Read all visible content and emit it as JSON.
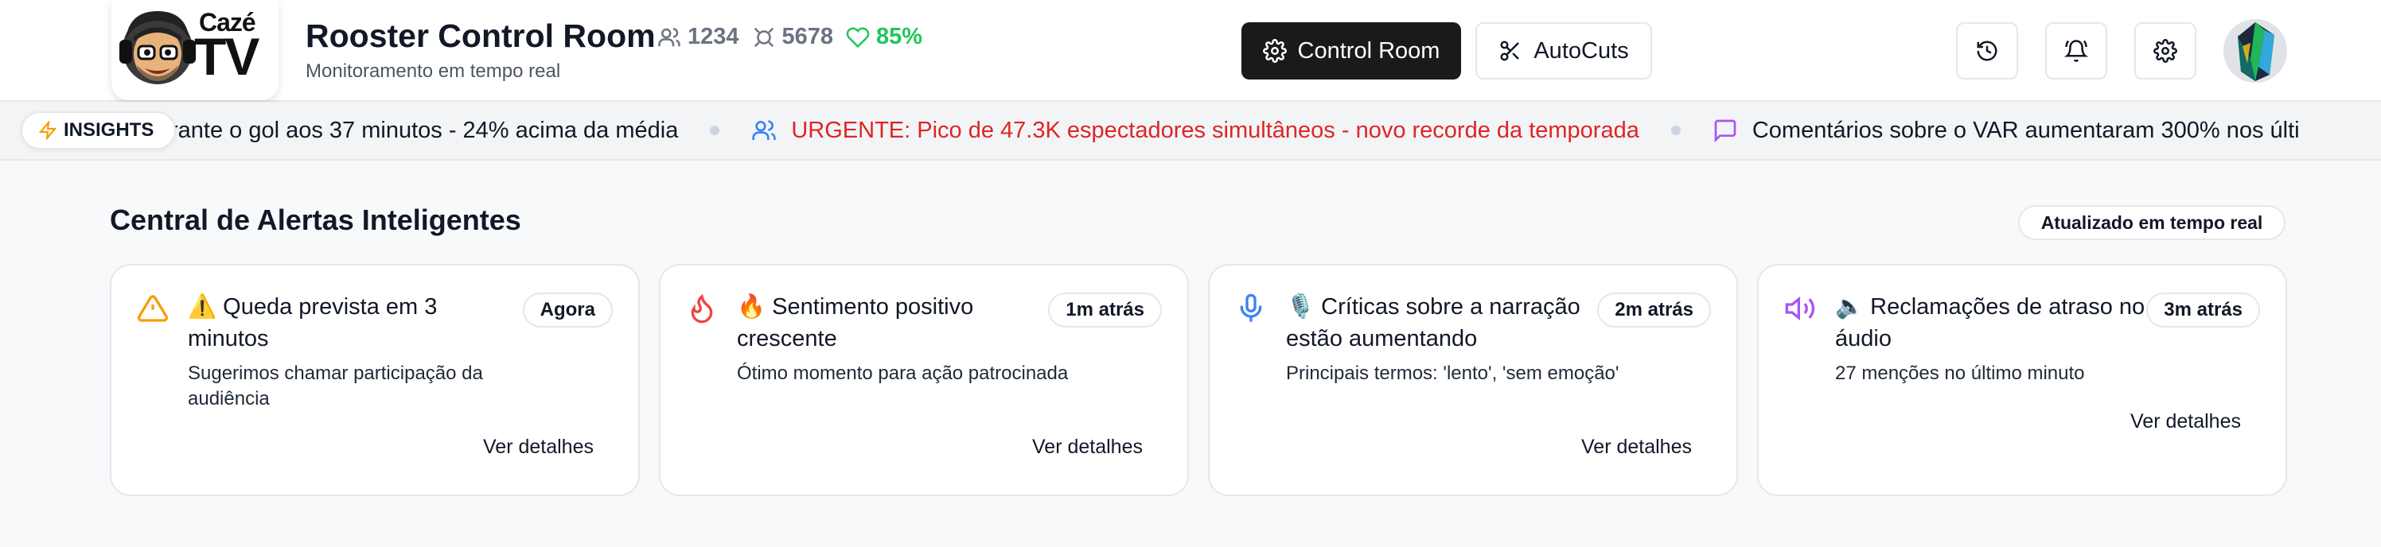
{
  "header": {
    "logo_text_top": "Cazé",
    "logo_text_bottom": "TV",
    "title": "Rooster Control Room",
    "subtitle": "Monitoramento em tempo real",
    "stats": {
      "viewers": "1234",
      "activity": "5678",
      "sentiment": "85%"
    },
    "buttons": {
      "control_room": "Control Room",
      "autocuts": "AutoCuts"
    }
  },
  "ticker": {
    "badge": "INSIGHTS",
    "items": [
      {
        "text": "rante o gol aos 37 minutos - 24% acima da média",
        "icon": "none"
      },
      {
        "text": "URGENTE: Pico de 47.3K espectadores simultâneos - novo recorde da temporada",
        "icon": "users-icon"
      },
      {
        "text": "Comentários sobre o VAR aumentaram 300% nos últi",
        "icon": "message-icon"
      }
    ]
  },
  "alerts": {
    "title": "Central de Alertas Inteligentes",
    "status_badge": "Atualizado em tempo real",
    "cards": [
      {
        "title": "⚠️ Queda prevista em 3 minutos",
        "time": "Agora",
        "description": "Sugerimos chamar participação da audiência",
        "action": "Ver detalhes",
        "icon": "warning-icon",
        "color": "#f59e0b"
      },
      {
        "title": "🔥 Sentimento positivo crescente",
        "time": "1m atrás",
        "description": "Ótimo momento para ação patrocinada",
        "action": "Ver detalhes",
        "icon": "flame-icon",
        "color": "#ef4444"
      },
      {
        "title": "🎙️ Críticas sobre a narração estão aumentando",
        "time": "2m atrás",
        "description": "Principais termos: 'lento', 'sem emoção'",
        "action": "Ver detalhes",
        "icon": "microphone-icon",
        "color": "#3b82f6"
      },
      {
        "title": "🔈 Reclamações de atraso no áudio",
        "time": "3m atrás",
        "description": "27 menções no último minuto",
        "action": "Ver detalhes",
        "icon": "speaker-icon",
        "color": "#a855f7"
      }
    ]
  },
  "colors": {
    "primary_button": "#1a1a1a",
    "urgent": "#dc2626",
    "positive": "#22c55e",
    "background": "#f8f9fa"
  }
}
